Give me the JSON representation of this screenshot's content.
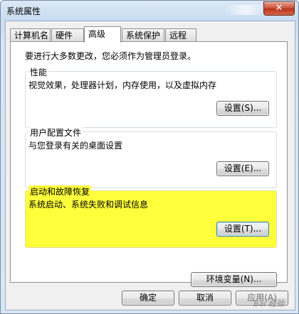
{
  "window": {
    "title": "系统属性",
    "close_glyph": "✕"
  },
  "tabs": [
    {
      "label": "计算机名"
    },
    {
      "label": "硬件"
    },
    {
      "label": "高级"
    },
    {
      "label": "系统保护"
    },
    {
      "label": "远程"
    }
  ],
  "active_tab": "高级",
  "intro_text": "要进行大多数更改，您必须作为管理员登录。",
  "groups": {
    "performance": {
      "title": "性能",
      "description": "视觉效果，处理器计划，内存使用，以及虚拟内存",
      "button": "设置(S)..."
    },
    "user_profiles": {
      "title": "用户配置文件",
      "description": "与您登录有关的桌面设置",
      "button": "设置(E)..."
    },
    "startup_recovery": {
      "title": "启动和故障恢复",
      "description": "系统启动、系统失败和调试信息",
      "button": "设置(T)...",
      "highlight_color": "#ffff3b"
    }
  },
  "env_button": "环境变量(N)...",
  "footer": {
    "ok": "确定",
    "cancel": "取消",
    "apply": "应用(A)"
  },
  "watermark": "Bai 经验"
}
